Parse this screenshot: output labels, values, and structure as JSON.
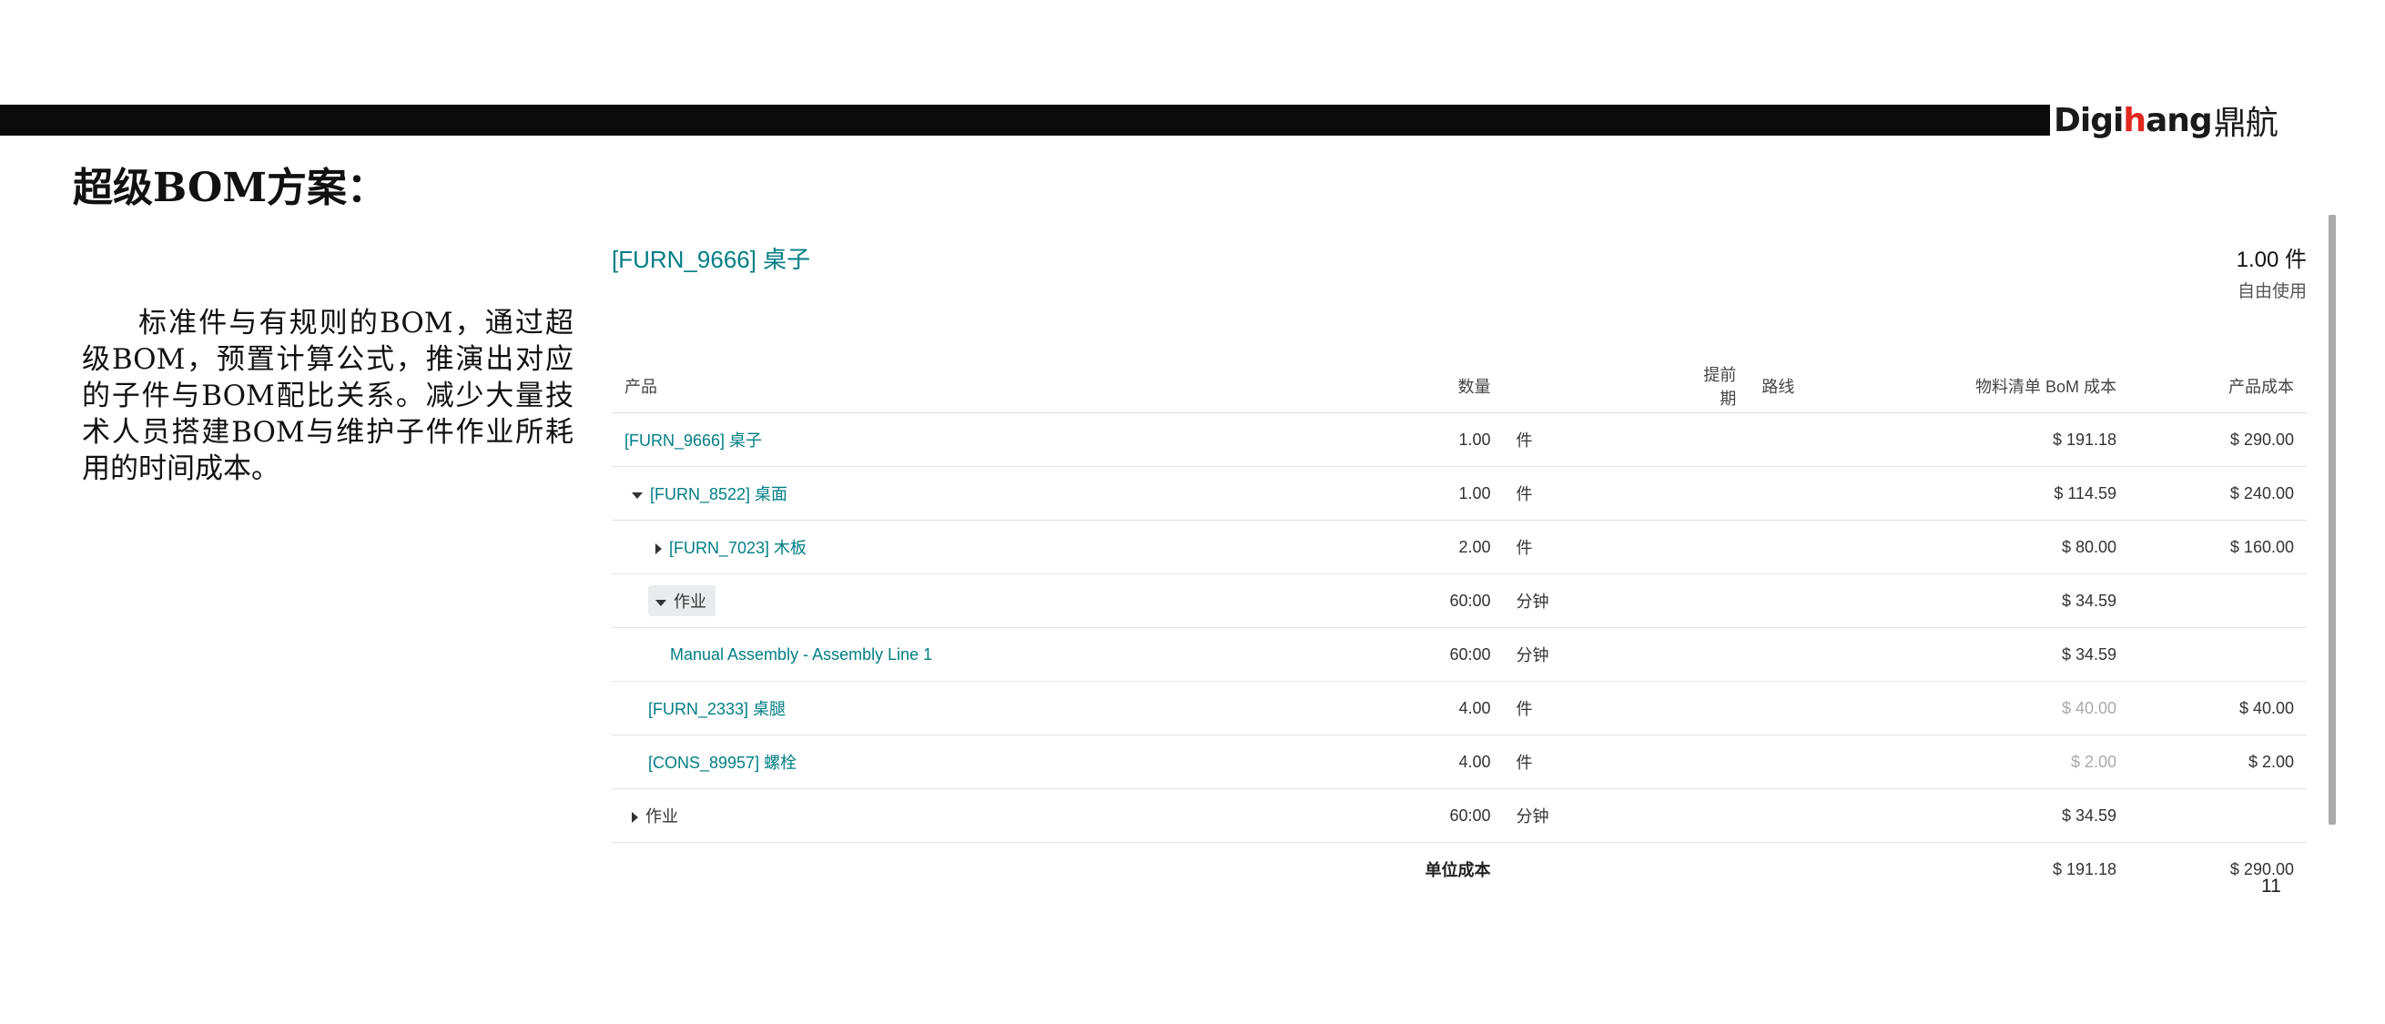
{
  "slide": {
    "title": "超级BOM方案：",
    "description": "标准件与有规则的BOM，通过超级BOM，预置计算公式，推演出对应的子件与BOM配比关系。减少大量技术人员搭建BOM与维护子件作业所耗用的时间成本。",
    "logo": {
      "latin_a": "Digi",
      "latin_accent": "h",
      "latin_b": "ang",
      "cn": "鼎航",
      "accent_color": "#e2271f"
    },
    "page_number": "11"
  },
  "report": {
    "product_title": "[FURN_9666] 桌子",
    "quantity": "1.00 件",
    "bom_type": "自由使用",
    "columns": {
      "product": "产品",
      "quantity": "数量",
      "lead_time": "提前期",
      "route": "路线",
      "bom_cost": "物料清单 BoM 成本",
      "product_cost": "产品成本"
    },
    "rows": [
      {
        "product": "[FURN_9666] 桌子",
        "qty": "1.00",
        "uom": "件",
        "bom_cost": "$ 191.18",
        "prod_cost": "$ 290.00"
      },
      {
        "product": "[FURN_8522] 桌面",
        "qty": "1.00",
        "uom": "件",
        "bom_cost": "$ 114.59",
        "prod_cost": "$ 240.00"
      },
      {
        "product": "[FURN_7023] 木板",
        "qty": "2.00",
        "uom": "件",
        "bom_cost": "$ 80.00",
        "prod_cost": "$ 160.00"
      },
      {
        "product": "作业",
        "qty": "60:00",
        "uom": "分钟",
        "bom_cost": "$ 34.59",
        "prod_cost": ""
      },
      {
        "product": "Manual Assembly - Assembly Line 1",
        "qty": "60:00",
        "uom": "分钟",
        "bom_cost": "$ 34.59",
        "prod_cost": ""
      },
      {
        "product": "[FURN_2333] 桌腿",
        "qty": "4.00",
        "uom": "件",
        "bom_cost": "$ 40.00",
        "prod_cost": "$ 40.00"
      },
      {
        "product": "[CONS_89957] 螺栓",
        "qty": "4.00",
        "uom": "件",
        "bom_cost": "$ 2.00",
        "prod_cost": "$ 2.00"
      },
      {
        "product": "作业",
        "qty": "60:00",
        "uom": "分钟",
        "bom_cost": "$ 34.59",
        "prod_cost": ""
      }
    ],
    "total": {
      "label": "单位成本",
      "bom_cost": "$ 191.18",
      "prod_cost": "$ 290.00"
    }
  },
  "colors": {
    "link": "#017e84",
    "top_bar": "#0b0b0b"
  }
}
